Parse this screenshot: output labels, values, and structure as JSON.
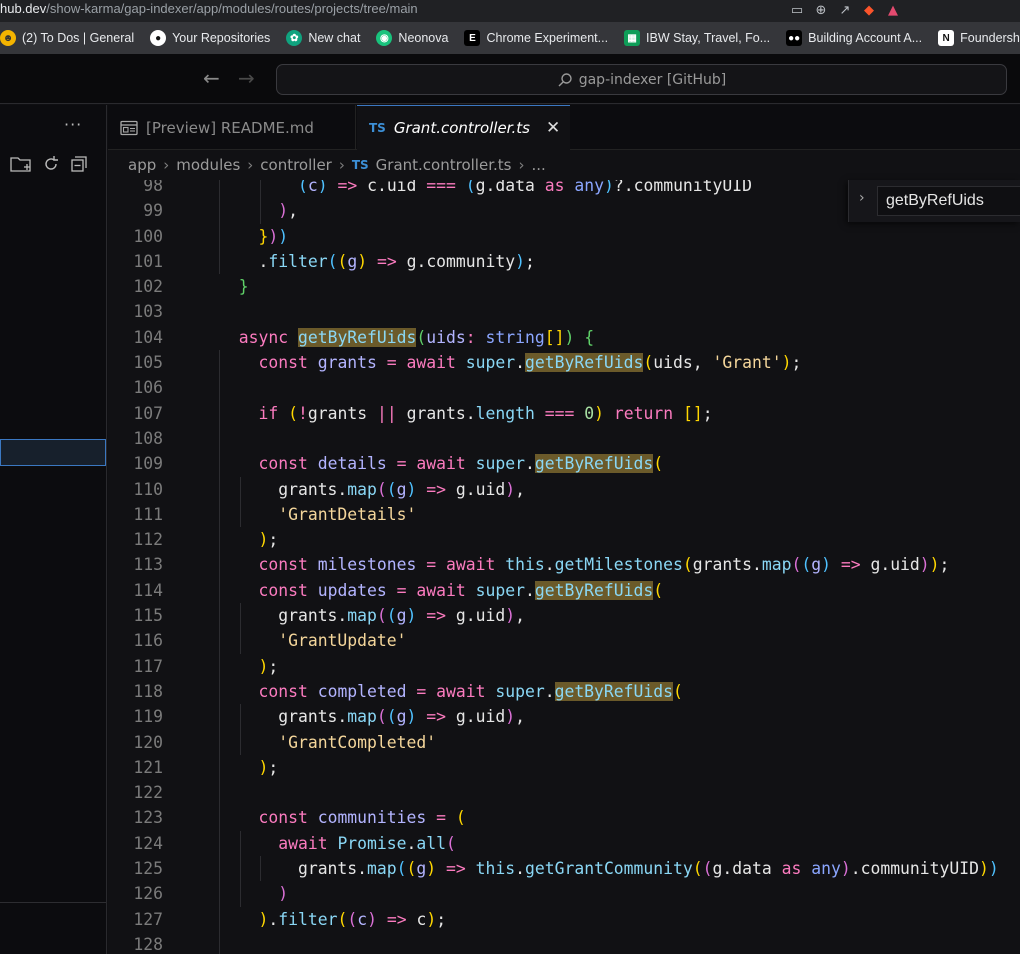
{
  "browser": {
    "url_host": "hub.dev",
    "url_path": "/show-karma/gap-indexer/app/modules/routes/projects/tree/main",
    "bookmarks": [
      {
        "label": "(2) To Dos | General",
        "icon": "smiley-icon",
        "color": "#f4b400"
      },
      {
        "label": "Your Repositories",
        "icon": "github-icon",
        "color": "#ffffff"
      },
      {
        "label": "New chat",
        "icon": "openai-icon",
        "color": "#10a37f"
      },
      {
        "label": "Neonova",
        "icon": "neonova-icon",
        "color": "#19c37d"
      },
      {
        "label": "Chrome Experiment...",
        "icon": "e-icon",
        "color": "#000000"
      },
      {
        "label": "IBW Stay, Travel, Fo...",
        "icon": "sheets-icon",
        "color": "#0f9d58"
      },
      {
        "label": "Building Account A...",
        "icon": "medium-icon",
        "color": "#000000"
      },
      {
        "label": "Foundership - Pro",
        "icon": "notion-icon",
        "color": "#ffffff"
      }
    ]
  },
  "title_bar": {
    "search_text": "gap-indexer [GitHub]"
  },
  "sidebar": {
    "more": "···"
  },
  "tabs": [
    {
      "label": "[Preview] README.md",
      "active": false
    },
    {
      "label": "Grant.controller.ts",
      "active": true,
      "badge": "TS"
    }
  ],
  "breadcrumbs": {
    "items": [
      "app",
      "modules",
      "controller"
    ],
    "file_badge": "TS",
    "file": "Grant.controller.ts",
    "tail": "..."
  },
  "find": {
    "value": "getByRefUids"
  },
  "editor": {
    "line_numbers": [
      "98",
      "99",
      "100",
      "101",
      "102",
      "103",
      "104",
      "105",
      "106",
      "107",
      "108",
      "109",
      "110",
      "111",
      "112",
      "113",
      "114",
      "115",
      "116",
      "117",
      "118",
      "119",
      "120",
      "121",
      "122",
      "123",
      "124",
      "125",
      "126",
      "127",
      "128"
    ],
    "search_term": "getByRefUids"
  }
}
